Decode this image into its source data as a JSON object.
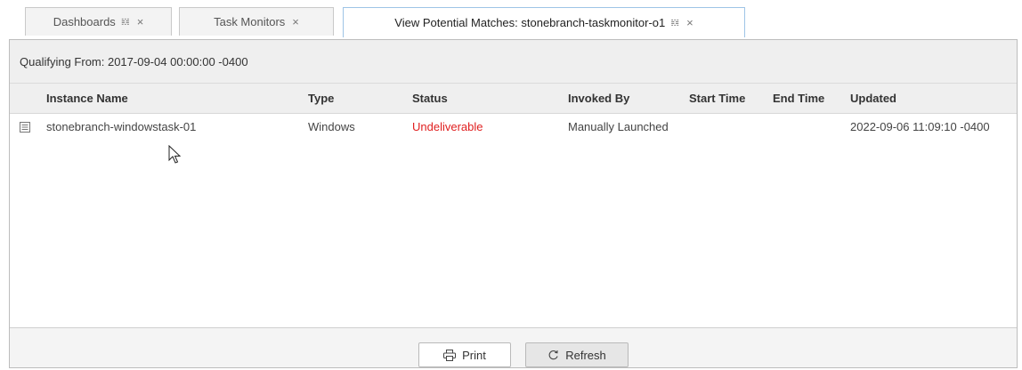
{
  "tabs": [
    {
      "label": "Dashboards",
      "pinned": true,
      "active": false
    },
    {
      "label": "Task Monitors",
      "pinned": false,
      "active": false
    },
    {
      "label": "View Potential Matches: stonebranch-taskmonitor-o1",
      "pinned": true,
      "active": true
    }
  ],
  "qualifying": {
    "text": "Qualifying From: 2017-09-04 00:00:00 -0400"
  },
  "grid": {
    "columns": [
      "Instance Name",
      "Type",
      "Status",
      "Invoked By",
      "Start Time",
      "End Time",
      "Updated"
    ],
    "rows": [
      {
        "instance_name": "stonebranch-windowstask-01",
        "type": "Windows",
        "status": "Undeliverable",
        "invoked_by": "Manually Launched",
        "start_time": "",
        "end_time": "",
        "updated": "2022-09-06 11:09:10 -0400"
      }
    ]
  },
  "footer": {
    "print_label": "Print",
    "refresh_label": "Refresh"
  },
  "colors": {
    "status_error": "#e02020",
    "active_tab_border": "#9ec4e6",
    "header_bg": "#efefef"
  },
  "icons": {
    "row": "details-icon",
    "print": "printer-icon",
    "refresh": "refresh-icon",
    "pin": "pin-icon",
    "close": "close-icon",
    "cursor": "mouse-pointer-icon"
  }
}
